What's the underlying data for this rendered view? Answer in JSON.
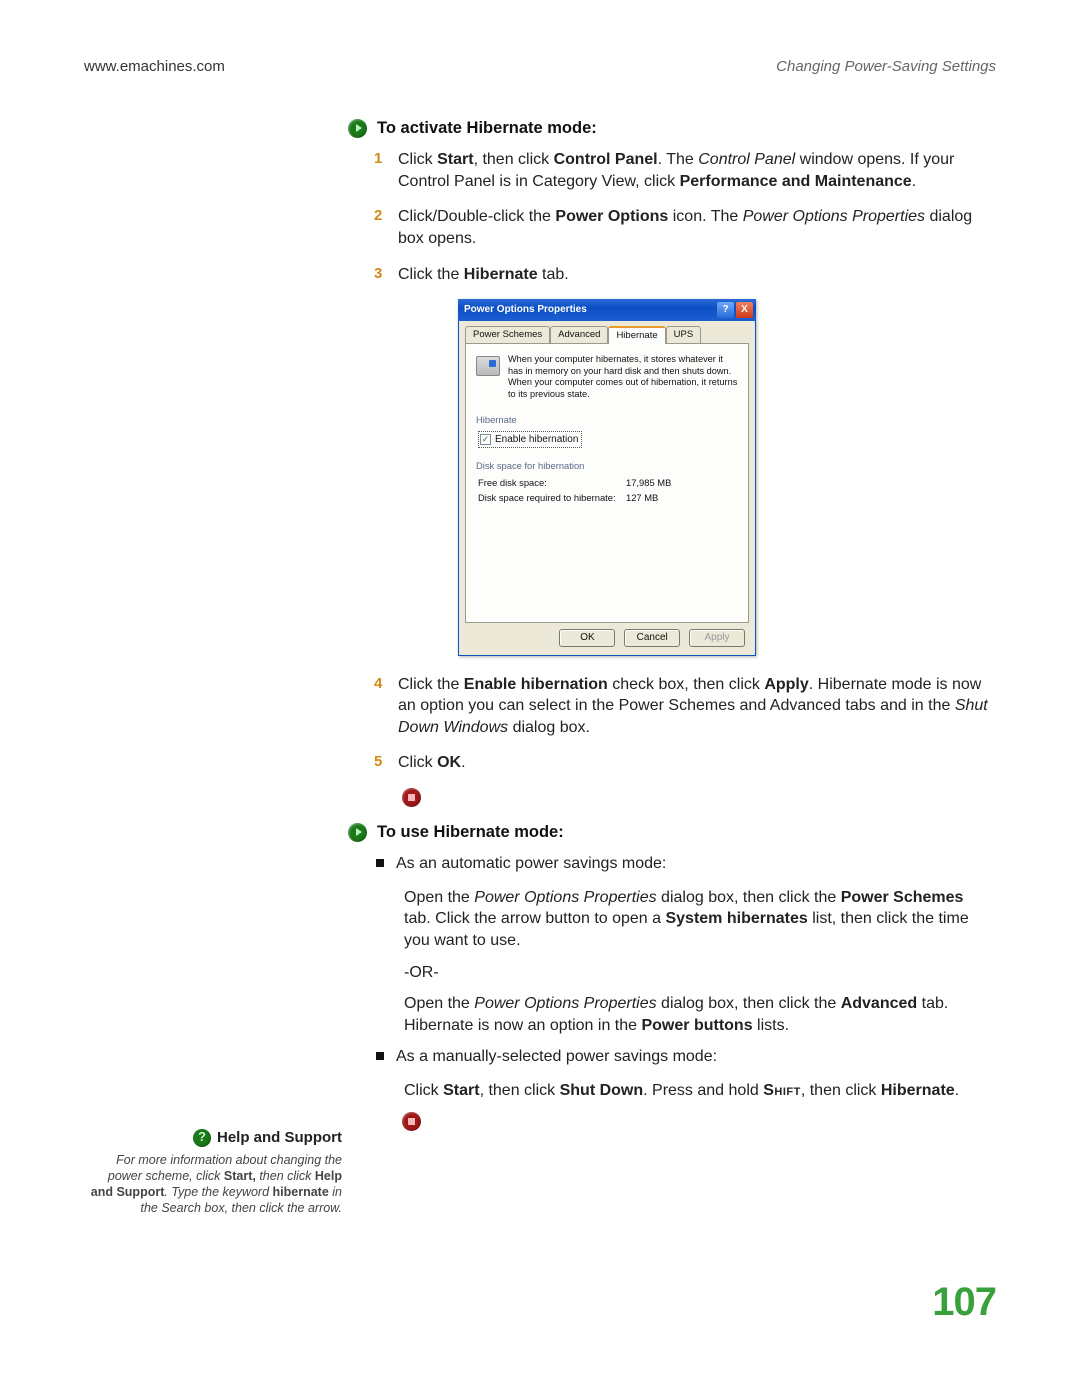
{
  "header": {
    "url": "www.emachines.com",
    "section": "Changing Power-Saving Settings"
  },
  "sections": {
    "activate": {
      "title": "To activate Hibernate mode:"
    },
    "use": {
      "title": "To use Hibernate mode:"
    }
  },
  "steps_activate": [
    {
      "num": "1",
      "pre": "Click ",
      "b1": "Start",
      "mid1": ", then click ",
      "b2": "Control Panel",
      "mid2": ". The ",
      "i1": "Control Panel",
      "mid3": " window opens. If your Control Panel is in Category View, click ",
      "b3": "Performance and Maintenance",
      "end": "."
    },
    {
      "num": "2",
      "pre": "Click/Double-click the ",
      "b1": "Power Options",
      "mid1": " icon. The ",
      "i1": "Power Options Properties",
      "end": " dialog box opens."
    },
    {
      "num": "3",
      "pre": "Click the ",
      "b1": "Hibernate",
      "end": " tab."
    },
    {
      "num": "4",
      "pre": "Click the ",
      "b1": "Enable hibernation",
      "mid1": " check box, then click ",
      "b2": "Apply",
      "mid2": ". Hibernate mode is now an option you can select in the Power Schemes and Advanced tabs and in the ",
      "i1": "Shut Down Windows",
      "end": " dialog box."
    },
    {
      "num": "5",
      "pre": "Click ",
      "b1": "OK",
      "end": "."
    }
  ],
  "use_mode": {
    "auto_intro": "As an automatic power savings mode:",
    "auto_para_pre": "Open the ",
    "auto_para_i1": "Power Options Properties",
    "auto_para_mid1": " dialog box, then click the ",
    "auto_para_b1": "Power Schemes",
    "auto_para_mid2": " tab. Click the arrow button to open a ",
    "auto_para_b2": "System hibernates",
    "auto_para_end": " list, then click the time you want to use.",
    "or": "-OR-",
    "auto_para2_pre": "Open the ",
    "auto_para2_i1": "Power Options Properties",
    "auto_para2_mid1": " dialog box, then click the ",
    "auto_para2_b1": "Advanced",
    "auto_para2_mid2": " tab. Hibernate is now an option in the ",
    "auto_para2_b2": "Power buttons",
    "auto_para2_end": " lists.",
    "manual_intro": "As a manually-selected power savings mode:",
    "manual_pre": "Click ",
    "manual_b1": "Start",
    "manual_mid1": ", then click ",
    "manual_b2": "Shut Down",
    "manual_mid2": ". Press and hold ",
    "manual_sc": "Shift",
    "manual_mid3": ", then click ",
    "manual_b3": "Hibernate",
    "manual_end": "."
  },
  "dialog": {
    "title": "Power Options Properties",
    "help_btn": "?",
    "close_btn": "X",
    "tabs": [
      "Power Schemes",
      "Advanced",
      "Hibernate",
      "UPS"
    ],
    "active_tab": "Hibernate",
    "description": "When your computer hibernates, it stores whatever it has in memory on your hard disk and then shuts down. When your computer comes out of hibernation, it returns to its previous state.",
    "group_hibernate": "Hibernate",
    "checkbox_label": "Enable hibernation",
    "checkbox_checked": "✓",
    "group_disk": "Disk space for hibernation",
    "free_label": "Free disk space:",
    "free_value": "17,985 MB",
    "req_label": "Disk space required to hibernate:",
    "req_value": "127 MB",
    "btn_ok": "OK",
    "btn_cancel": "Cancel",
    "btn_apply": "Apply"
  },
  "help_support": {
    "title": "Help and Support",
    "pre": "For more information about changing the power scheme, click ",
    "b1": "Start,",
    "mid1": " then click ",
    "b2": "Help and Support",
    "mid2": ". Type the keyword ",
    "b3": "hibernate",
    "end": " in the Search box, then click the arrow."
  },
  "page_number": "107"
}
